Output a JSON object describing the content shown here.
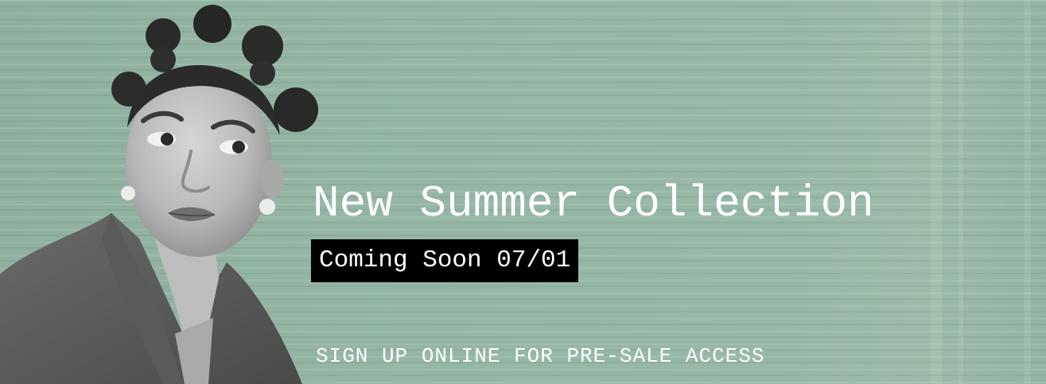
{
  "hero": {
    "headline": "New Summer Collection",
    "coming_soon": "Coming Soon 07/01",
    "cta": "SIGN UP ONLINE FOR PRE-SALE ACCESS",
    "portrait_image": "woman-portrait-grayscale"
  },
  "colors": {
    "background": "#93b4a3",
    "headline_text": "#ffffff",
    "badge_background": "#000000",
    "badge_text": "#ffffff"
  }
}
